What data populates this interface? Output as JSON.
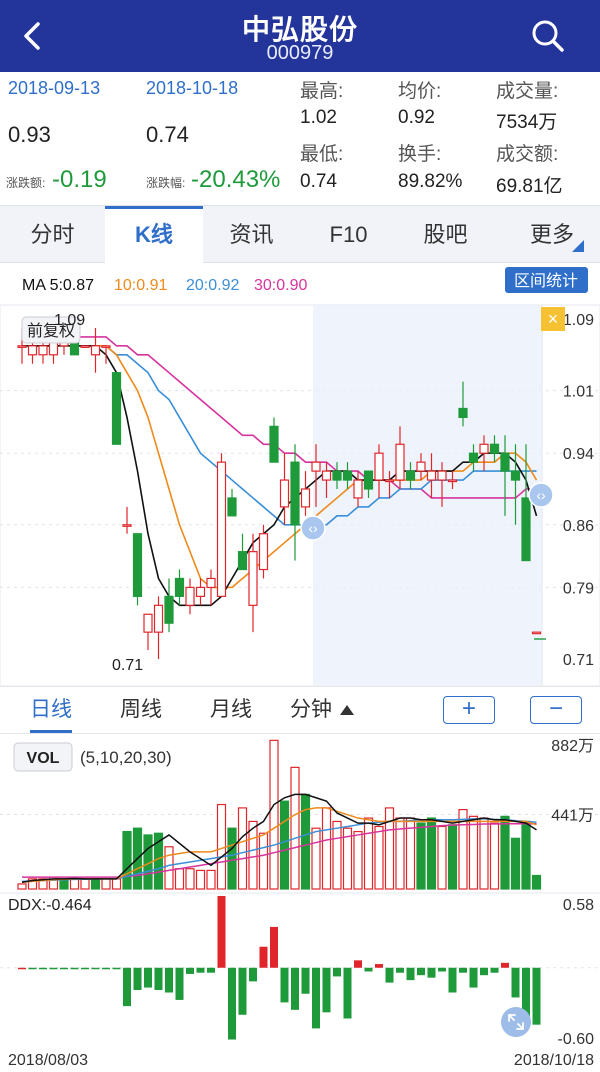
{
  "header": {
    "title": "中弘股份",
    "code": "000979"
  },
  "info": {
    "date_start": "2018-09-13",
    "date_end": "2018-10-18",
    "price_start": "0.93",
    "price_end": "0.74",
    "change_label": "涨跌额:",
    "change_value": "-0.19",
    "pct_label": "涨跌幅:",
    "pct_value": "-20.43%",
    "high_label": "最高:",
    "high_value": "1.02",
    "low_label": "最低:",
    "low_value": "0.74",
    "avg_label": "均价:",
    "avg_value": "0.92",
    "turnover_label": "换手:",
    "turnover_value": "89.82%",
    "volume_label": "成交量:",
    "volume_value": "7534万",
    "amount_label": "成交额:",
    "amount_value": "69.81亿"
  },
  "tabs": [
    "分时",
    "K线",
    "资讯",
    "F10",
    "股吧",
    "更多"
  ],
  "active_tab": 1,
  "ma": {
    "ma5": "MA 5:0.87",
    "ma10": "10:0.91",
    "ma20": "20:0.92",
    "ma30": "30:0.90",
    "stats_button": "区间统计",
    "fuquan_button": "前复权",
    "close_mark": "×"
  },
  "subtabs": [
    "日线",
    "周线",
    "月线",
    "分钟"
  ],
  "zoom_in": "+",
  "zoom_out": "−",
  "colors": {
    "up": "#e0262b",
    "down": "#1e9a3b",
    "ma5": "#111111",
    "ma10": "#ee8a1c",
    "ma20": "#3a8fd8",
    "ma30": "#d6339e",
    "accent": "#2f6fc9",
    "header": "#23359a"
  },
  "chart_data": {
    "type": "candlestick",
    "y_ticks": [
      "1.09",
      "1.01",
      "0.94",
      "0.86",
      "0.79",
      "0.71"
    ],
    "ylim": [
      0.71,
      1.09
    ],
    "max_label": "1.09",
    "min_label": "0.71",
    "candles": [
      {
        "o": 1.06,
        "h": 1.08,
        "l": 1.04,
        "c": 1.06
      },
      {
        "o": 1.05,
        "h": 1.07,
        "l": 1.04,
        "c": 1.06
      },
      {
        "o": 1.05,
        "h": 1.07,
        "l": 1.04,
        "c": 1.06
      },
      {
        "o": 1.05,
        "h": 1.09,
        "l": 1.04,
        "c": 1.07
      },
      {
        "o": 1.06,
        "h": 1.08,
        "l": 1.05,
        "c": 1.07
      },
      {
        "o": 1.07,
        "h": 1.07,
        "l": 1.05,
        "c": 1.05
      },
      {
        "o": 1.06,
        "h": 1.06,
        "l": 1.06,
        "c": 1.06
      },
      {
        "o": 1.05,
        "h": 1.08,
        "l": 1.03,
        "c": 1.06
      },
      {
        "o": 1.06,
        "h": 1.06,
        "l": 1.04,
        "c": 1.06
      },
      {
        "o": 1.03,
        "h": 1.03,
        "l": 0.95,
        "c": 0.95
      },
      {
        "o": 0.86,
        "h": 0.88,
        "l": 0.85,
        "c": 0.86
      },
      {
        "o": 0.85,
        "h": 0.85,
        "l": 0.77,
        "c": 0.78
      },
      {
        "o": 0.74,
        "h": 0.74,
        "l": 0.72,
        "c": 0.76
      },
      {
        "o": 0.74,
        "h": 0.78,
        "l": 0.71,
        "c": 0.77
      },
      {
        "o": 0.78,
        "h": 0.8,
        "l": 0.74,
        "c": 0.75
      },
      {
        "o": 0.8,
        "h": 0.81,
        "l": 0.77,
        "c": 0.78
      },
      {
        "o": 0.77,
        "h": 0.8,
        "l": 0.76,
        "c": 0.79
      },
      {
        "o": 0.78,
        "h": 0.8,
        "l": 0.77,
        "c": 0.79
      },
      {
        "o": 0.79,
        "h": 0.81,
        "l": 0.77,
        "c": 0.8
      },
      {
        "o": 0.78,
        "h": 0.94,
        "l": 0.78,
        "c": 0.93
      },
      {
        "o": 0.89,
        "h": 0.9,
        "l": 0.87,
        "c": 0.87
      },
      {
        "o": 0.83,
        "h": 0.85,
        "l": 0.81,
        "c": 0.81
      },
      {
        "o": 0.77,
        "h": 0.85,
        "l": 0.74,
        "c": 0.83
      },
      {
        "o": 0.81,
        "h": 0.86,
        "l": 0.8,
        "c": 0.85
      },
      {
        "o": 0.97,
        "h": 0.98,
        "l": 0.93,
        "c": 0.93
      },
      {
        "o": 0.88,
        "h": 0.94,
        "l": 0.86,
        "c": 0.91
      },
      {
        "o": 0.93,
        "h": 0.95,
        "l": 0.82,
        "c": 0.86
      },
      {
        "o": 0.88,
        "h": 0.92,
        "l": 0.87,
        "c": 0.9
      },
      {
        "o": 0.92,
        "h": 0.95,
        "l": 0.88,
        "c": 0.93
      },
      {
        "o": 0.91,
        "h": 0.93,
        "l": 0.89,
        "c": 0.92
      },
      {
        "o": 0.92,
        "h": 0.93,
        "l": 0.9,
        "c": 0.91
      },
      {
        "o": 0.92,
        "h": 0.93,
        "l": 0.9,
        "c": 0.91
      },
      {
        "o": 0.89,
        "h": 0.92,
        "l": 0.88,
        "c": 0.91
      },
      {
        "o": 0.92,
        "h": 0.92,
        "l": 0.89,
        "c": 0.9
      },
      {
        "o": 0.91,
        "h": 0.95,
        "l": 0.89,
        "c": 0.94
      },
      {
        "o": 0.91,
        "h": 0.92,
        "l": 0.89,
        "c": 0.91
      },
      {
        "o": 0.91,
        "h": 0.97,
        "l": 0.9,
        "c": 0.95
      },
      {
        "o": 0.92,
        "h": 0.93,
        "l": 0.9,
        "c": 0.91
      },
      {
        "o": 0.92,
        "h": 0.94,
        "l": 0.91,
        "c": 0.93
      },
      {
        "o": 0.91,
        "h": 0.94,
        "l": 0.89,
        "c": 0.92
      },
      {
        "o": 0.91,
        "h": 0.93,
        "l": 0.88,
        "c": 0.92
      },
      {
        "o": 0.91,
        "h": 0.92,
        "l": 0.9,
        "c": 0.91
      },
      {
        "o": 0.99,
        "h": 1.02,
        "l": 0.97,
        "c": 0.98
      },
      {
        "o": 0.94,
        "h": 0.95,
        "l": 0.92,
        "c": 0.93
      },
      {
        "o": 0.94,
        "h": 0.96,
        "l": 0.92,
        "c": 0.95
      },
      {
        "o": 0.95,
        "h": 0.96,
        "l": 0.93,
        "c": 0.94
      },
      {
        "o": 0.94,
        "h": 0.96,
        "l": 0.87,
        "c": 0.92
      },
      {
        "o": 0.92,
        "h": 0.95,
        "l": 0.86,
        "c": 0.91
      },
      {
        "o": 0.89,
        "h": 0.95,
        "l": 0.82,
        "c": 0.82
      },
      {
        "o": 0.74,
        "h": 0.74,
        "l": 0.74,
        "c": 0.74
      }
    ],
    "ma_lines": {
      "ma5": [
        1.06,
        1.06,
        1.06,
        1.06,
        1.06,
        1.06,
        1.06,
        1.06,
        1.05,
        1.03,
        0.98,
        0.92,
        0.85,
        0.8,
        0.78,
        0.77,
        0.77,
        0.77,
        0.77,
        0.78,
        0.8,
        0.82,
        0.84,
        0.85,
        0.86,
        0.88,
        0.89,
        0.9,
        0.91,
        0.92,
        0.92,
        0.92,
        0.91,
        0.91,
        0.91,
        0.91,
        0.92,
        0.92,
        0.92,
        0.92,
        0.92,
        0.92,
        0.93,
        0.93,
        0.94,
        0.94,
        0.94,
        0.93,
        0.91,
        0.87
      ],
      "ma10": [
        1.06,
        1.06,
        1.06,
        1.06,
        1.06,
        1.06,
        1.06,
        1.06,
        1.06,
        1.05,
        1.03,
        1.01,
        0.98,
        0.94,
        0.9,
        0.86,
        0.83,
        0.8,
        0.79,
        0.79,
        0.79,
        0.8,
        0.81,
        0.82,
        0.83,
        0.84,
        0.85,
        0.86,
        0.87,
        0.88,
        0.89,
        0.9,
        0.91,
        0.91,
        0.91,
        0.91,
        0.91,
        0.91,
        0.91,
        0.92,
        0.92,
        0.92,
        0.92,
        0.93,
        0.93,
        0.93,
        0.94,
        0.94,
        0.93,
        0.91
      ],
      "ma20": [
        1.06,
        1.06,
        1.06,
        1.06,
        1.06,
        1.06,
        1.06,
        1.06,
        1.06,
        1.05,
        1.05,
        1.04,
        1.03,
        1.01,
        1.0,
        0.98,
        0.96,
        0.94,
        0.93,
        0.92,
        0.91,
        0.9,
        0.89,
        0.88,
        0.87,
        0.86,
        0.86,
        0.86,
        0.86,
        0.86,
        0.87,
        0.87,
        0.88,
        0.88,
        0.89,
        0.89,
        0.9,
        0.9,
        0.9,
        0.91,
        0.91,
        0.91,
        0.91,
        0.92,
        0.92,
        0.92,
        0.92,
        0.92,
        0.92,
        0.92
      ],
      "ma30": [
        1.07,
        1.07,
        1.07,
        1.07,
        1.07,
        1.07,
        1.07,
        1.07,
        1.07,
        1.06,
        1.06,
        1.05,
        1.05,
        1.04,
        1.03,
        1.02,
        1.01,
        1.0,
        0.99,
        0.98,
        0.97,
        0.96,
        0.96,
        0.95,
        0.95,
        0.94,
        0.94,
        0.93,
        0.93,
        0.93,
        0.92,
        0.92,
        0.92,
        0.91,
        0.91,
        0.91,
        0.9,
        0.9,
        0.9,
        0.89,
        0.89,
        0.89,
        0.89,
        0.89,
        0.89,
        0.89,
        0.89,
        0.89,
        0.9,
        0.9
      ]
    },
    "vol": {
      "label": "VOL",
      "params": "(5,10,20,30)",
      "max_label": "882万",
      "mid_label": "441万",
      "max": 882,
      "values": [
        30,
        60,
        60,
        70,
        60,
        60,
        60,
        60,
        60,
        60,
        340,
        360,
        320,
        330,
        250,
        120,
        120,
        110,
        110,
        500,
        360,
        480,
        400,
        330,
        880,
        520,
        720,
        560,
        360,
        480,
        400,
        360,
        340,
        420,
        370,
        480,
        420,
        420,
        390,
        420,
        370,
        380,
        470,
        430,
        420,
        390,
        430,
        300,
        400,
        80
      ],
      "up_flags": [
        1,
        1,
        1,
        1,
        0,
        1,
        1,
        0,
        1,
        1,
        0,
        0,
        0,
        0,
        1,
        1,
        1,
        1,
        1,
        1,
        0,
        1,
        1,
        1,
        1,
        0,
        1,
        0,
        1,
        1,
        1,
        1,
        1,
        1,
        1,
        1,
        1,
        1,
        0,
        0,
        1,
        0,
        1,
        1,
        1,
        1,
        0,
        0,
        0,
        0
      ],
      "ma5": [
        40,
        50,
        55,
        60,
        60,
        62,
        60,
        60,
        60,
        60,
        120,
        180,
        240,
        280,
        320,
        270,
        220,
        180,
        140,
        190,
        240,
        310,
        360,
        400,
        500,
        540,
        560,
        560,
        540,
        520,
        450,
        420,
        390,
        390,
        380,
        400,
        420,
        420,
        410,
        410,
        400,
        390,
        400,
        410,
        420,
        410,
        410,
        400,
        390,
        350
      ],
      "ma10": [
        40,
        45,
        50,
        55,
        58,
        60,
        60,
        60,
        60,
        60,
        90,
        120,
        150,
        180,
        200,
        210,
        220,
        220,
        220,
        240,
        260,
        280,
        300,
        320,
        360,
        400,
        440,
        470,
        480,
        480,
        460,
        440,
        420,
        410,
        400,
        400,
        400,
        400,
        400,
        400,
        400,
        400,
        400,
        400,
        400,
        400,
        400,
        400,
        400,
        380
      ],
      "ma20": [
        45,
        48,
        50,
        52,
        55,
        57,
        58,
        60,
        60,
        60,
        75,
        90,
        105,
        120,
        140,
        150,
        160,
        170,
        180,
        190,
        200,
        215,
        230,
        245,
        260,
        280,
        300,
        320,
        340,
        350,
        360,
        370,
        380,
        390,
        395,
        400,
        400,
        405,
        410,
        410,
        410,
        410,
        412,
        415,
        415,
        412,
        410,
        405,
        400,
        395
      ],
      "ma30": [
        70,
        70,
        70,
        70,
        70,
        70,
        70,
        70,
        70,
        70,
        75,
        80,
        90,
        100,
        110,
        120,
        130,
        140,
        150,
        160,
        170,
        180,
        190,
        200,
        215,
        230,
        245,
        260,
        275,
        290,
        300,
        310,
        320,
        330,
        340,
        350,
        355,
        360,
        365,
        370,
        375,
        378,
        380,
        382,
        385,
        385,
        386,
        386,
        386,
        386
      ]
    },
    "ddx": {
      "label": "DDX:-0.464",
      "max_label": "0.58",
      "min_label": "-0.60",
      "ylim": [
        -0.6,
        0.58
      ],
      "values": [
        0,
        -0.01,
        -0.01,
        -0.01,
        -0.01,
        -0.01,
        -0.01,
        -0.01,
        -0.01,
        -0.01,
        -0.31,
        -0.18,
        -0.16,
        -0.18,
        -0.2,
        -0.26,
        -0.05,
        -0.04,
        -0.04,
        0.58,
        -0.58,
        -0.38,
        -0.11,
        0.17,
        0.33,
        -0.28,
        -0.34,
        -0.21,
        -0.49,
        -0.36,
        -0.07,
        -0.41,
        0.06,
        -0.03,
        0.03,
        -0.12,
        -0.04,
        -0.1,
        -0.06,
        -0.08,
        -0.03,
        -0.2,
        -0.04,
        -0.16,
        -0.06,
        -0.04,
        0.04,
        -0.24,
        -0.42,
        -0.46
      ],
      "date_start": "2018/08/03",
      "date_end": "2018/10/18"
    }
  }
}
